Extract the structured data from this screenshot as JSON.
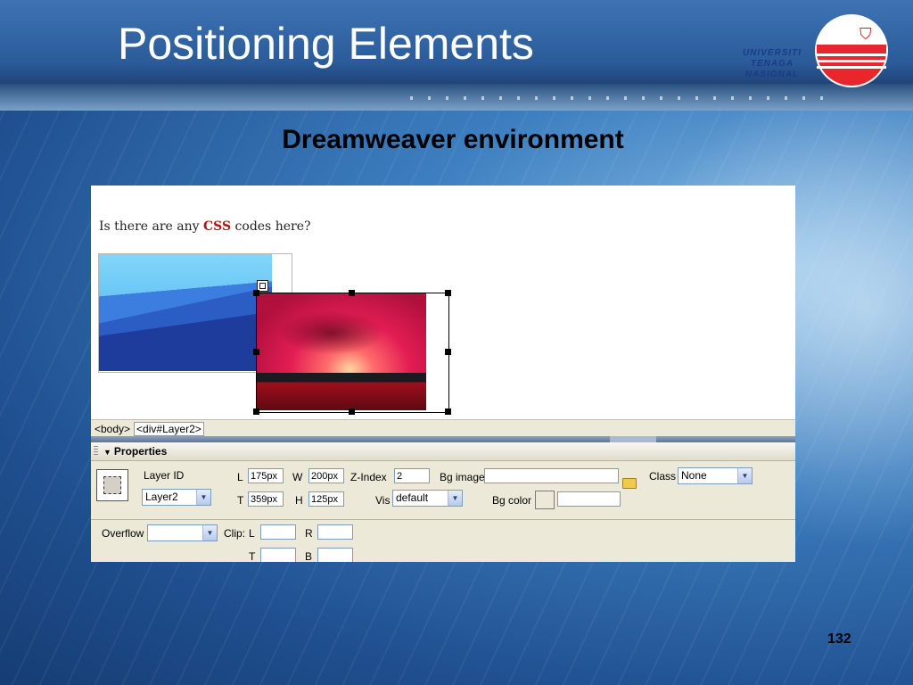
{
  "slide": {
    "title": "Positioning Elements",
    "subtitle": "Dreamweaver environment",
    "page_number": "132"
  },
  "logo": {
    "line1": "UNIVERSITI",
    "line2": "TENAGA",
    "line3": "NASIONAL"
  },
  "design_view": {
    "text_before": "Is there are any ",
    "text_highlight": "CSS",
    "text_after": " codes here?"
  },
  "tag_selector": {
    "tags": [
      "<body>",
      "<div#Layer2>"
    ]
  },
  "properties": {
    "title": "Properties",
    "layer_id_label": "Layer ID",
    "layer_id_value": "Layer2",
    "left_label": "L",
    "left_value": "175px",
    "width_label": "W",
    "width_value": "200px",
    "zindex_label": "Z-Index",
    "zindex_value": "2",
    "bgimage_label": "Bg image",
    "bgimage_value": "",
    "class_label": "Class",
    "class_value": "None",
    "top_label": "T",
    "top_value": "359px",
    "height_label": "H",
    "height_value": "125px",
    "vis_label": "Vis",
    "vis_value": "default",
    "bgcolor_label": "Bg color",
    "bgcolor_value": "",
    "overflow_label": "Overflow",
    "overflow_value": "",
    "clip_label": "Clip:",
    "clip_l_label": "L",
    "clip_l_value": "",
    "clip_r_label": "R",
    "clip_r_value": "",
    "clip_t_label": "T",
    "clip_t_value": "",
    "clip_b_label": "B",
    "clip_b_value": ""
  },
  "colors": {
    "accent": "#2b5b99",
    "css_highlight": "#b11515",
    "panel": "#ece9d8"
  }
}
